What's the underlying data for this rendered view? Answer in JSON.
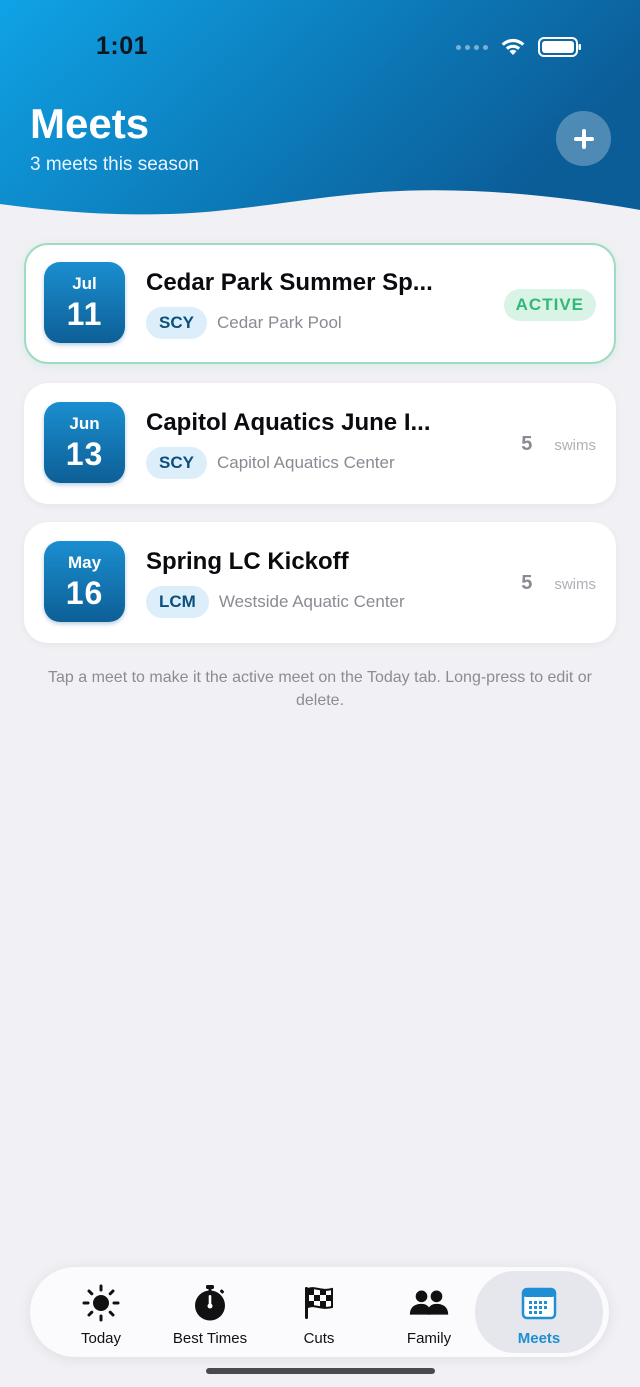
{
  "status": {
    "time": "1:01"
  },
  "header": {
    "title": "Meets",
    "subtitle": "3 meets this season",
    "add_icon": "plus-icon"
  },
  "meets": [
    {
      "month": "Jul",
      "day": "11",
      "name": "Cedar Park Summer Sp...",
      "course": "SCY",
      "venue": "Cedar Park Pool",
      "status": "ACTIVE"
    },
    {
      "month": "Jun",
      "day": "13",
      "name": "Capitol Aquatics June I...",
      "course": "SCY",
      "venue": "Capitol Aquatics Center",
      "swims": "5",
      "swims_label": "swims"
    },
    {
      "month": "May",
      "day": "16",
      "name": "Spring LC Kickoff",
      "course": "LCM",
      "venue": "Westside Aquatic Center",
      "swims": "5",
      "swims_label": "swims"
    }
  ],
  "hint": "Tap a meet to make it the active meet on the Today tab. Long-press to edit or delete.",
  "tabs": [
    {
      "label": "Today",
      "icon": "sun-icon"
    },
    {
      "label": "Best Times",
      "icon": "stopwatch-icon"
    },
    {
      "label": "Cuts",
      "icon": "checkered-flag-icon"
    },
    {
      "label": "Family",
      "icon": "people-icon"
    },
    {
      "label": "Meets",
      "icon": "calendar-icon",
      "selected": true
    }
  ],
  "colors": {
    "header_gradient_start": "#0fa3e6",
    "header_gradient_end": "#0b5d98",
    "accent": "#1f8ed3",
    "active_green": "#34b877",
    "background": "#f1f1f5"
  }
}
